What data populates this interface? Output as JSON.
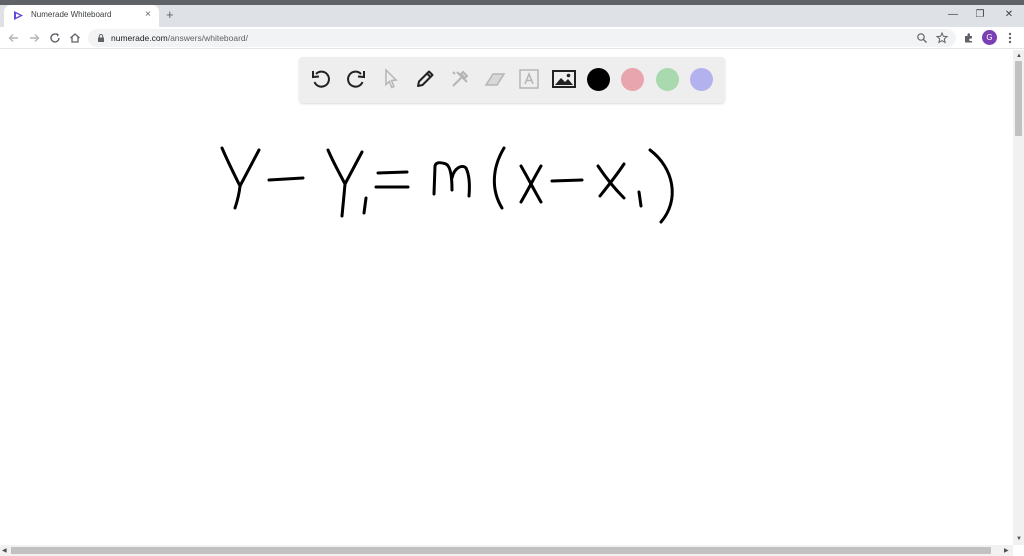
{
  "browser": {
    "tab_title": "Numerade Whiteboard",
    "tab_close": "×",
    "new_tab": "+",
    "window_controls": {
      "minimize": "—",
      "restore": "❐",
      "close": "✕"
    },
    "url_host": "numerade.com",
    "url_path": "/answers/whiteboard/",
    "profile_initial": "G",
    "profile_color": "#7b3fb5"
  },
  "toolbar": {
    "tools": [
      "undo-icon",
      "redo-icon",
      "pointer-icon",
      "pen-icon",
      "tools-icon",
      "eraser-icon",
      "text-icon",
      "image-icon"
    ],
    "colors": [
      "#000000",
      "#e8a5ad",
      "#a9d9ae",
      "#b3b1ee"
    ],
    "selected_color": "#000000"
  },
  "whiteboard": {
    "equation": "y − y₁ = m(x − x₁)",
    "ink_color": "#000000"
  }
}
